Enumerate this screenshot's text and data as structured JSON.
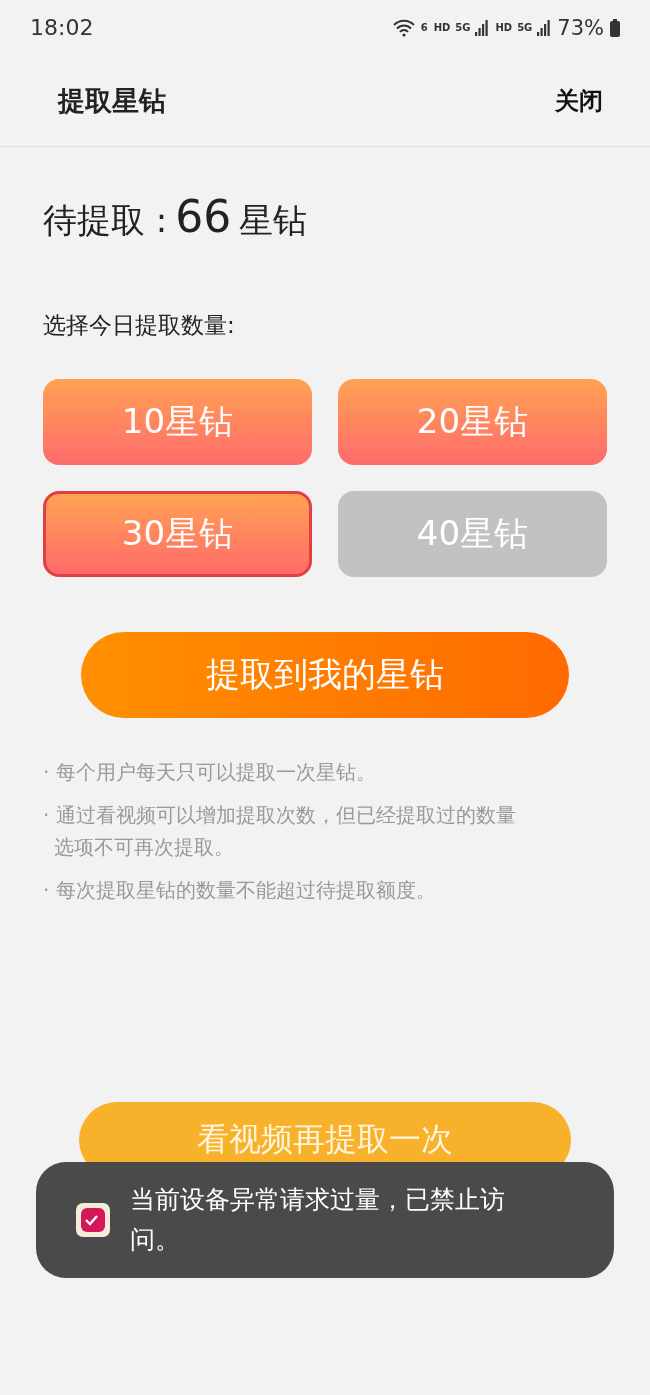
{
  "status_bar": {
    "time": "18:02",
    "wifi_badge": "6",
    "networks": [
      {
        "hd": "HD",
        "type": "5G"
      },
      {
        "hd": "HD",
        "type": "5G"
      }
    ],
    "battery": "73%"
  },
  "header": {
    "title": "提取星钻",
    "close": "关闭"
  },
  "pending": {
    "label": "待提取 :",
    "amount": "66",
    "unit": "星钻"
  },
  "choose_label": "选择今日提取数量:",
  "options": [
    {
      "label": "10星钻",
      "selected": false,
      "disabled": false
    },
    {
      "label": "20星钻",
      "selected": false,
      "disabled": false
    },
    {
      "label": "30星钻",
      "selected": true,
      "disabled": false
    },
    {
      "label": "40星钻",
      "selected": false,
      "disabled": true
    }
  ],
  "withdraw_button": "提取到我的星钻",
  "notes": [
    "· 每个用户每天只可以提取一次星钻。",
    "· 通过看视频可以增加提取次数，但已经提取过的数量选项不可再次提取。",
    "· 每次提取星钻的数量不能超过待提取额度。"
  ],
  "video_button": "看视频再提取一次",
  "toast": {
    "message": "当前设备异常请求过量，已禁止访问。"
  }
}
